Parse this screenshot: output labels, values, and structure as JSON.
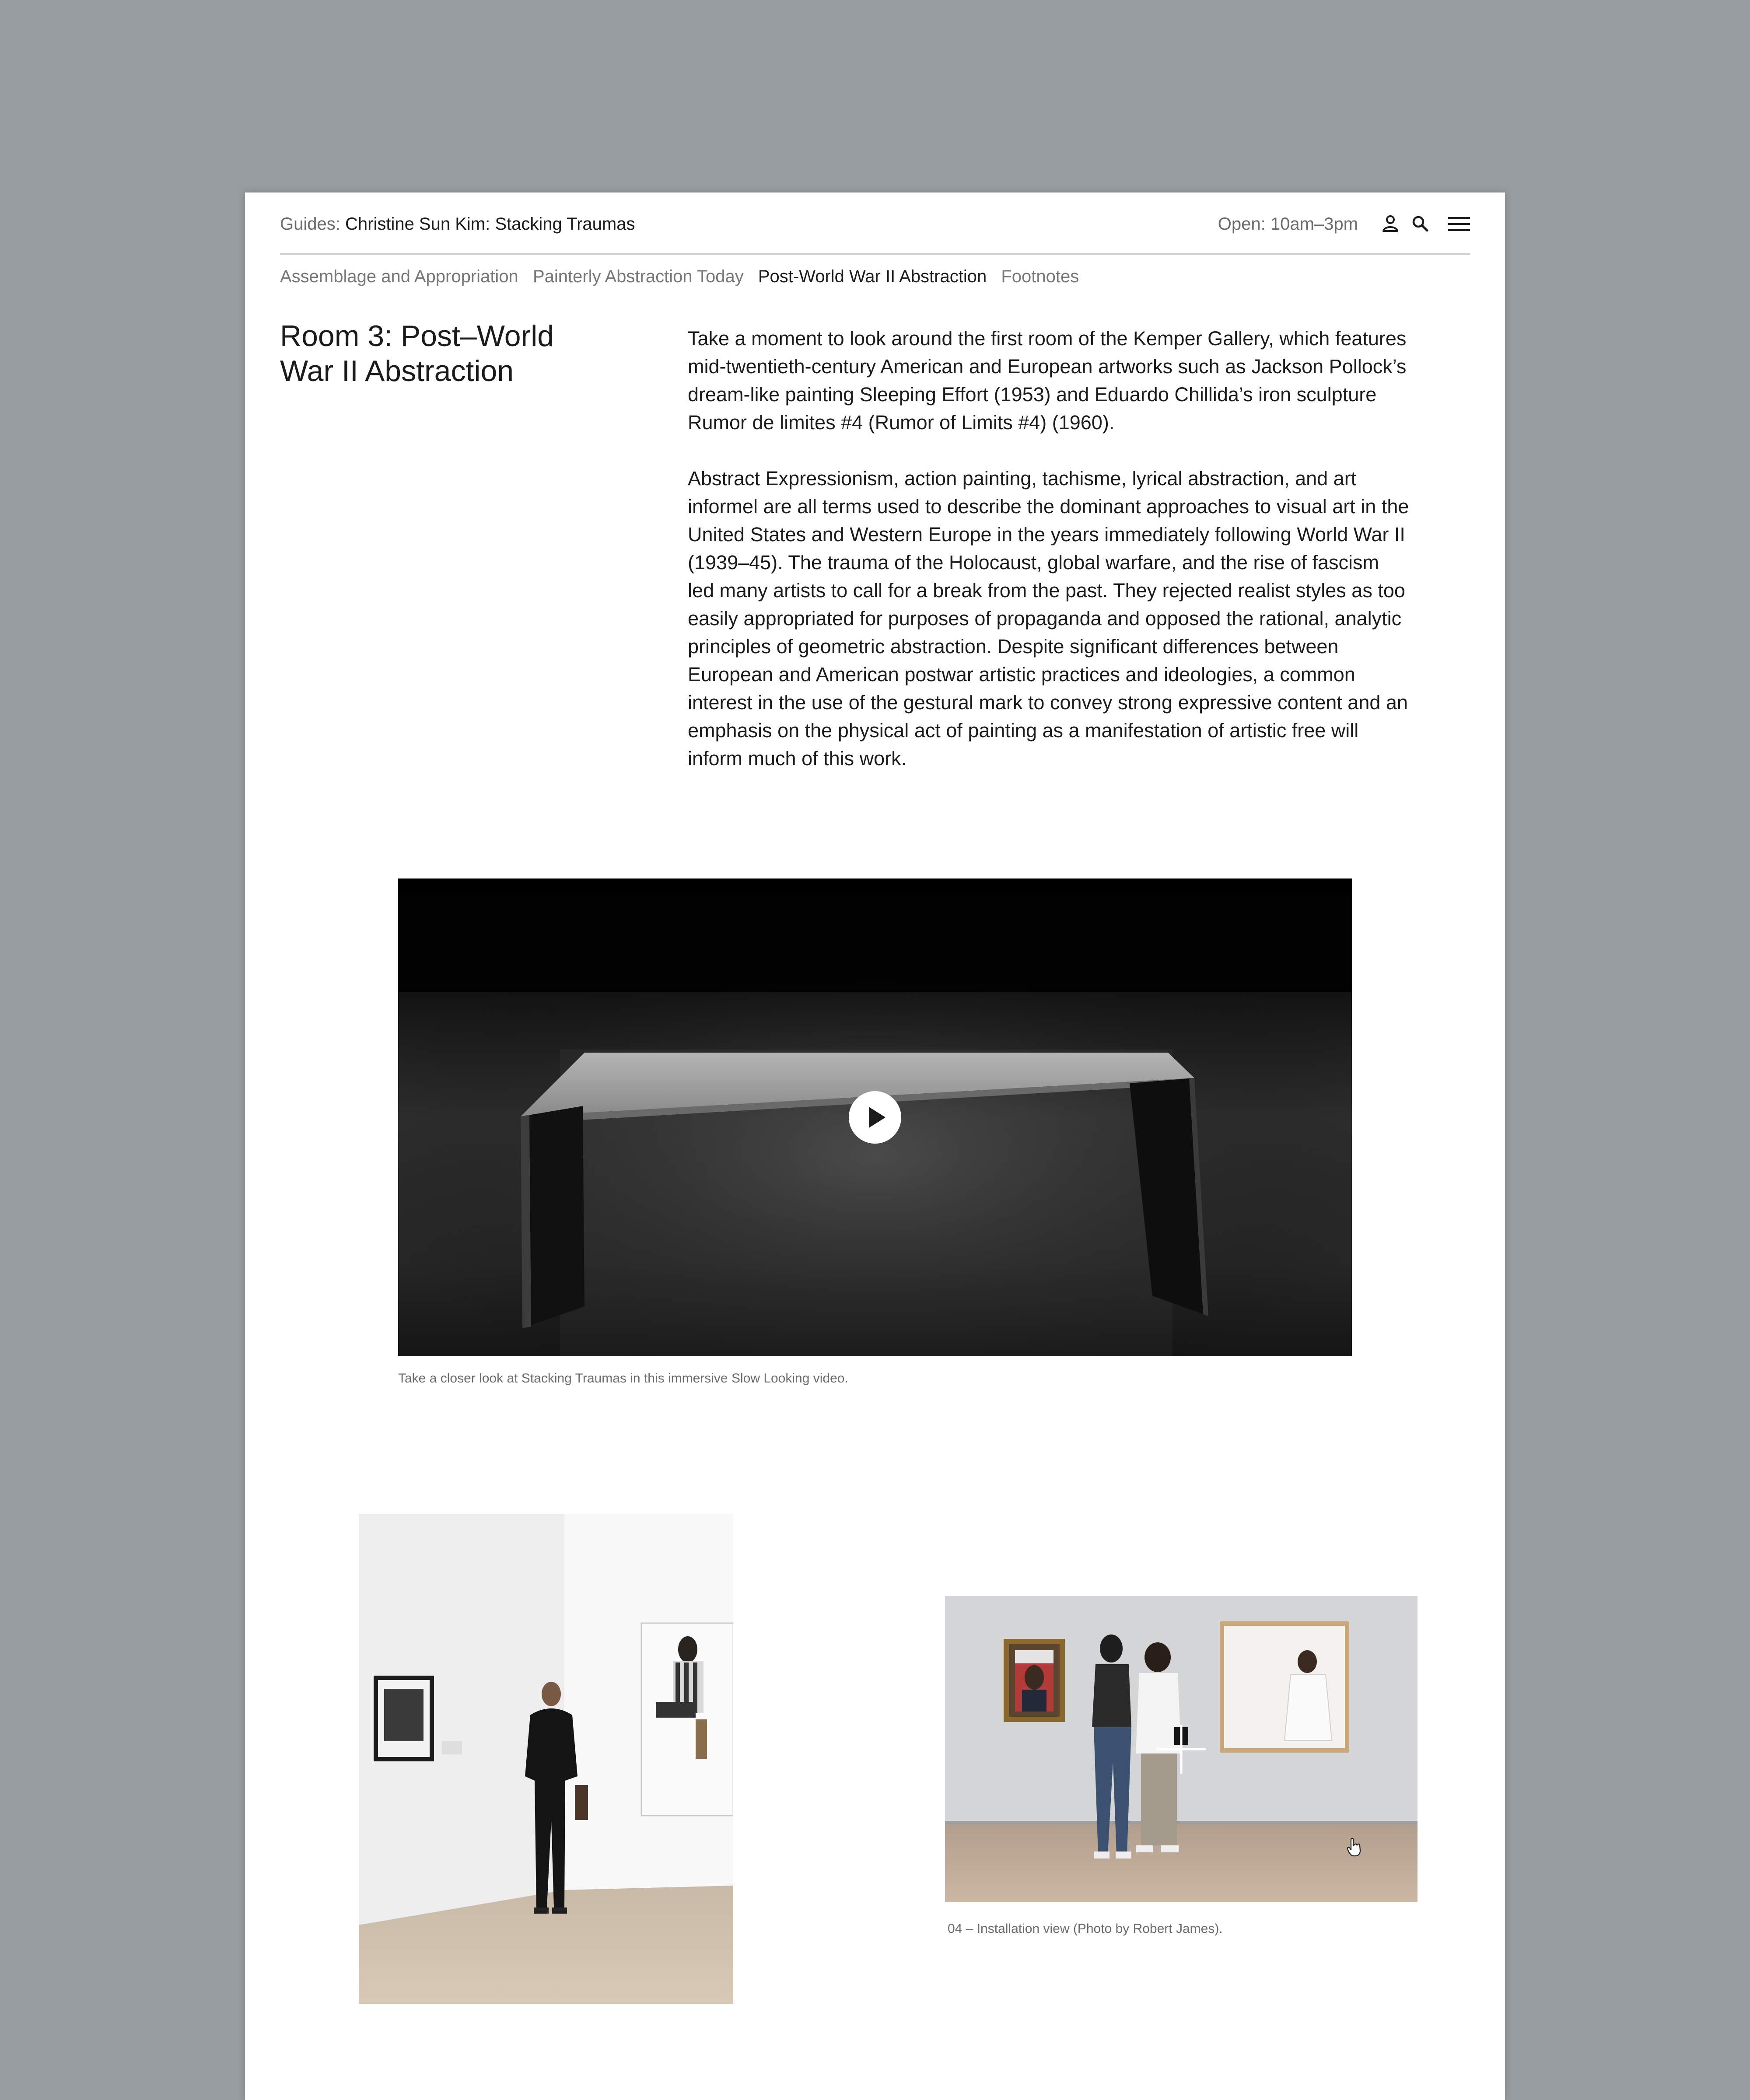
{
  "header": {
    "guide_prefix": "Guides:",
    "guide_title": "Christine Sun Kim: Stacking Traumas",
    "hours": "Open: 10am–3pm",
    "icons": [
      "user-icon",
      "search-icon",
      "menu-icon"
    ]
  },
  "subnav": {
    "items": [
      {
        "label": "Assemblage and Appropriation",
        "active": false
      },
      {
        "label": "Painterly Abstraction Today",
        "active": false
      },
      {
        "label": "Post-World War II Abstraction",
        "active": true
      },
      {
        "label": "Footnotes",
        "active": false
      }
    ]
  },
  "main": {
    "title": "Room 3: Post–World War II Abstraction",
    "paragraphs": [
      "Take a moment to look around the first room of the Kemper Gallery, which features mid-twentieth-century American and European artworks such as Jackson Pollock’s dream-like painting Sleeping Effort (1953) and Eduardo Chillida’s iron sculpture Rumor de limites #4 (Rumor of Limits #4) (1960).",
      "Abstract Expressionism, action painting, tachisme, lyrical abstraction, and art informel are all terms used to describe the dominant approaches to visual art in the United States and Western Europe in the years immediately following World War II (1939–45). The trauma of the Holocaust, global warfare, and the rise of fascism led many artists to call for a break from the past. They rejected realist styles as too easily appropriated for purposes of propaganda and opposed the rational, analytic principles of geometric abstraction. Despite significant differences between European and American postwar artistic practices and ideologies, a common interest in the use of the gestural mark to convey strong expressive content and an emphasis on the physical act of painting as a manifestation of artistic free will inform much of this work."
    ]
  },
  "video": {
    "caption": "Take a closer look at Stacking Traumas in this immersive Slow Looking video.",
    "play_icon": "play-icon"
  },
  "gallery": {
    "right_caption": "04 – Installation view (Photo by Robert James).",
    "overlay_icon": "plus-icon"
  },
  "colors": {
    "backdrop": "#989da1",
    "page": "#ffffff",
    "muted_text": "#6b6b6b",
    "text": "#1b1b1b"
  }
}
